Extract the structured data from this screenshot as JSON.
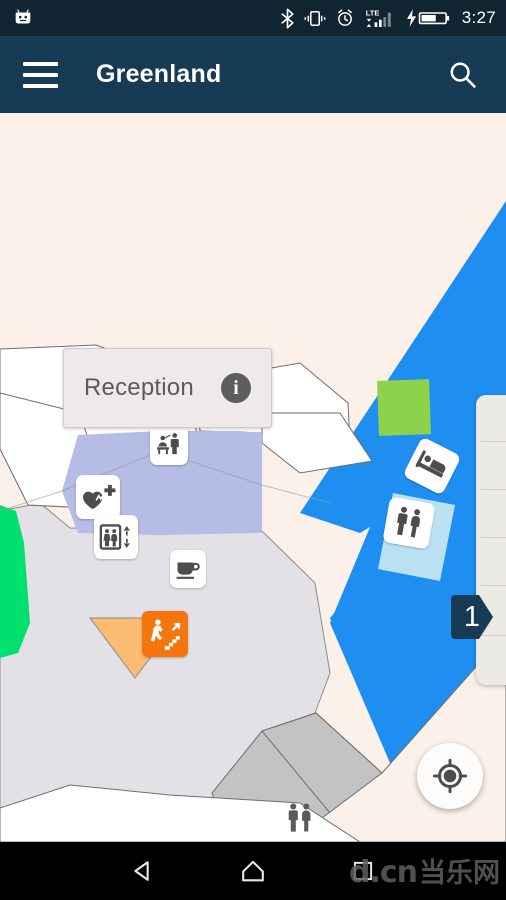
{
  "statusbar": {
    "clock": "3:27",
    "icons": [
      {
        "name": "android-robot-icon"
      },
      {
        "name": "bluetooth-icon"
      },
      {
        "name": "vibrate-icon"
      },
      {
        "name": "alarm-icon"
      },
      {
        "name": "lte-signal-icon",
        "label": "LTE"
      },
      {
        "name": "battery-charging-icon"
      }
    ]
  },
  "appbar": {
    "title": "Greenland",
    "menu_icon": "hamburger-menu-icon",
    "search_icon": "search-icon",
    "background_color": "#173b54"
  },
  "map": {
    "background_color": "#fbf1e9",
    "water_color": "#1f8ef1",
    "building_color": "#b5bce6",
    "plaza_color": "#e3e1e5",
    "structure_color": "#c3c3c3",
    "green_park_color": "#8ed24c",
    "green_zone_color": "#00e06e",
    "escalator_zone_color": "#fbbd73",
    "restroom_zone_color": "#b9e1f2",
    "corridor_color": "#ffffff",
    "callout": {
      "label": "Reception",
      "info_icon": "info-icon",
      "info_glyph": "i"
    },
    "pois": [
      {
        "name": "poi-reception-desk",
        "icon": "reception-desk-icon",
        "label": "Reception"
      },
      {
        "name": "poi-first-aid",
        "icon": "first-aid-heart-icon",
        "label": "First Aid"
      },
      {
        "name": "poi-elevator",
        "icon": "elevator-icon",
        "label": "Elevator"
      },
      {
        "name": "poi-cafe",
        "icon": "coffee-cup-icon",
        "label": "Cafe"
      },
      {
        "name": "poi-hotel",
        "icon": "bed-icon",
        "label": "Hotel"
      },
      {
        "name": "poi-restroom",
        "icon": "restroom-icon",
        "label": "Restroom"
      },
      {
        "name": "poi-escalator",
        "icon": "escalator-icon",
        "label": "Escalator"
      },
      {
        "name": "poi-restroom-south",
        "icon": "restroom-icon",
        "label": "Restroom"
      }
    ]
  },
  "floor_selector": {
    "current_floor": "1",
    "badge_color": "#173b54",
    "strip_color": "#eceae4",
    "levels": [
      "",
      "",
      "",
      "",
      "",
      ""
    ]
  },
  "fab": {
    "name": "my-location-button",
    "icon": "my-location-icon"
  },
  "navbar": {
    "back_icon": "back-triangle-icon",
    "home_icon": "home-icon",
    "recents_icon": "recents-square-icon",
    "watermark_latin": "d.cn",
    "watermark_cn": "当乐网"
  }
}
